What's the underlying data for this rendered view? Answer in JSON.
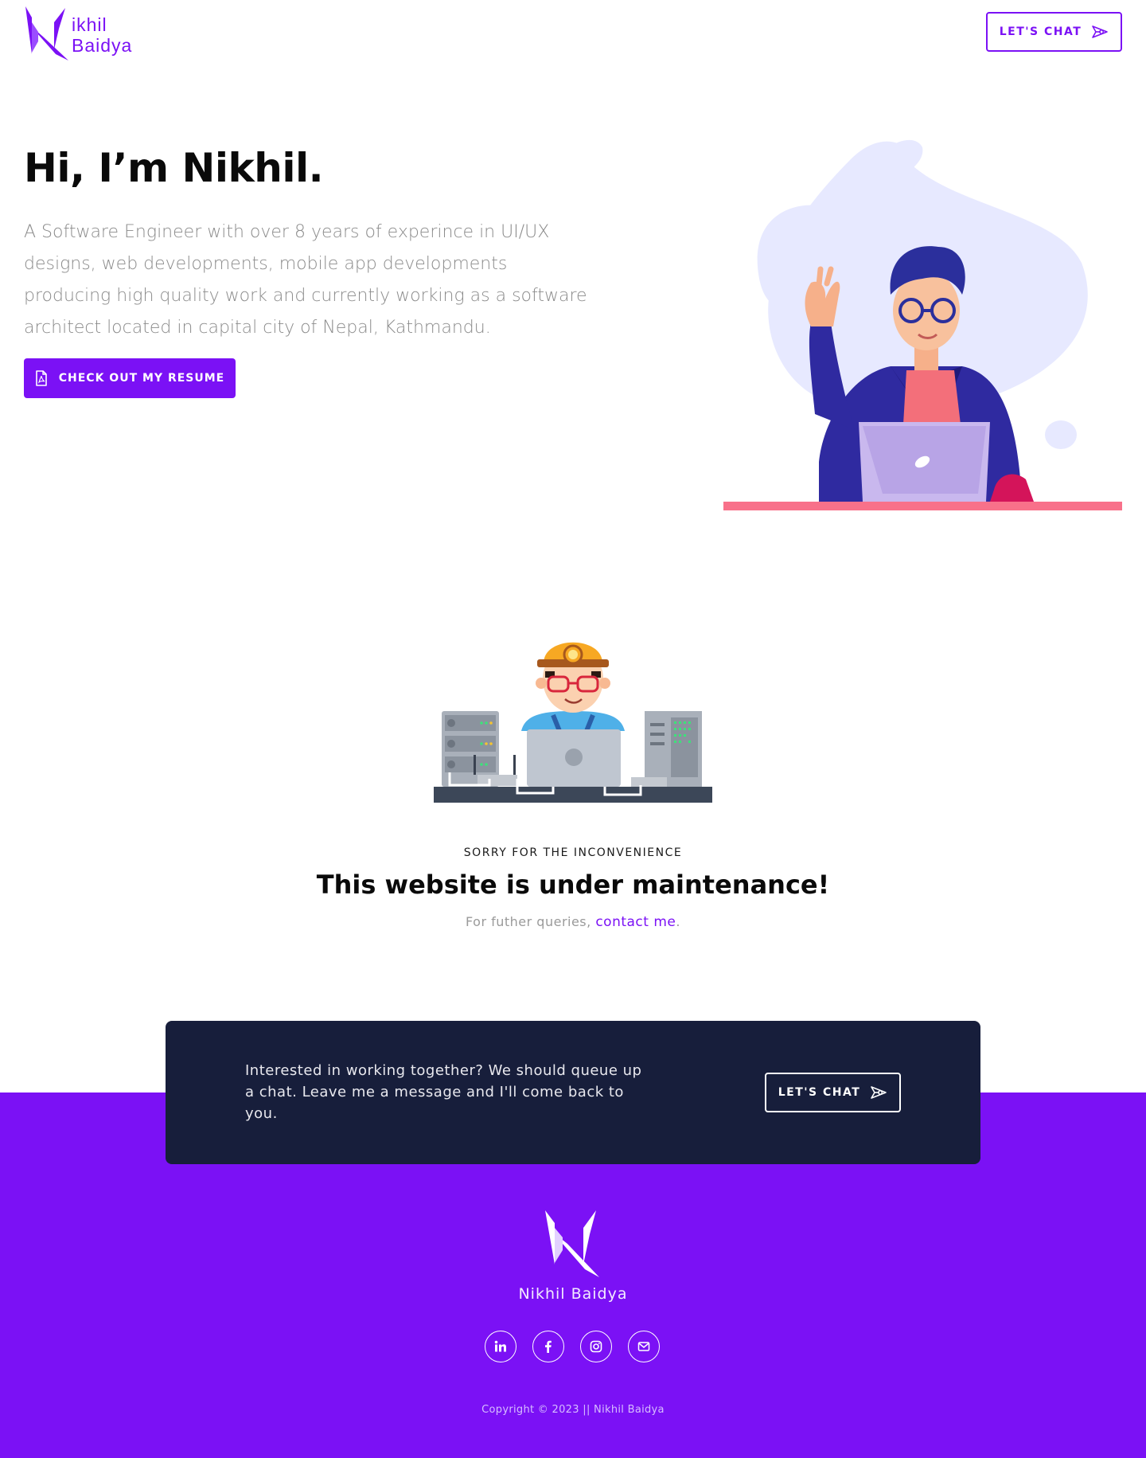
{
  "header": {
    "logo_name_line1": "ikhil",
    "logo_name_line2": "Baidya",
    "chat_label": "LET'S CHAT"
  },
  "hero": {
    "title": "Hi, I’m Nikhil.",
    "description": "A Software Engineer with over 8 years of experince in UI/UX designs, web developments, mobile app developments producing high quality work and currently working as a software architect located in capital city of Nepal, Kathmandu.",
    "resume_label": "CHECK OUT MY RESUME"
  },
  "maintenance": {
    "eyebrow": "SORRY FOR THE INCONVENIENCE",
    "title": "This website is under maintenance!",
    "queries_prefix": "For futher queries,",
    "contact_link": "contact me",
    "queries_suffix": "."
  },
  "cta": {
    "text": "Interested in working together? We should queue up a chat. Leave me a message and I'll come back to you.",
    "chat_label": "LET'S CHAT"
  },
  "footer": {
    "name": "Nikhil Baidya",
    "socials": [
      "linkedin-icon",
      "facebook-icon",
      "instagram-icon",
      "email-icon"
    ],
    "copyright": "Copyright © 2023 || Nikhil Baidya"
  },
  "colors": {
    "brand": "#7b11f5",
    "cta_bg": "#171e3b",
    "desk_accent": "#f8718a"
  }
}
